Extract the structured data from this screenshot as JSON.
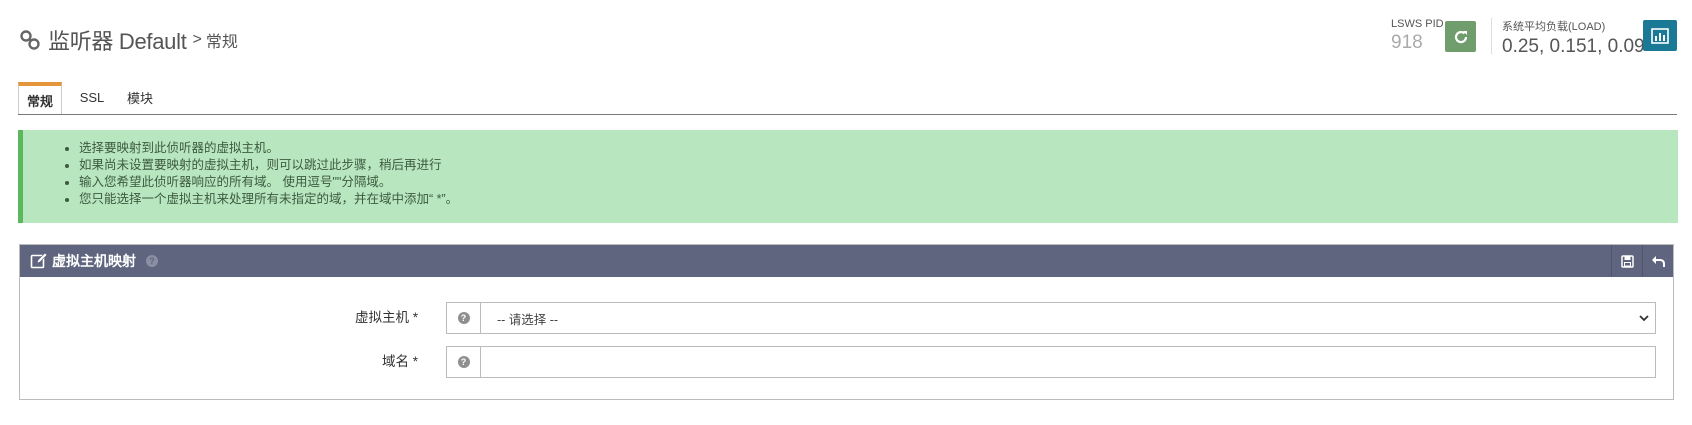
{
  "header": {
    "title": "监听器 Default",
    "separator": ">",
    "subtitle": "常规"
  },
  "status": {
    "pid_label": "LSWS PID",
    "pid_value": "918",
    "load_label": "系统平均负载(LOAD)",
    "load_value": "0.25, 0.151, 0.09"
  },
  "tabs": [
    {
      "label": "常规",
      "active": true
    },
    {
      "label": "SSL",
      "active": false
    },
    {
      "label": "模块",
      "active": false
    }
  ],
  "info": {
    "items": [
      "选择要映射到此侦听器的虚拟主机。",
      "如果尚未设置要映射的虚拟主机，则可以跳过此步骤，稍后再进行",
      "输入您希望此侦听器响应的所有域。 使用逗号\"\"分隔域。",
      "您只能选择一个虚拟主机来处理所有未指定的域，并在域中添加“ *”。"
    ]
  },
  "panel": {
    "title": "虚拟主机映射",
    "fields": [
      {
        "label": "虚拟主机 *",
        "type": "select",
        "value": "-- 请选择 --"
      },
      {
        "label": "域名 *",
        "type": "text",
        "value": ""
      }
    ]
  },
  "colors": {
    "accent_tab": "#e5953a",
    "refresh_btn": "#6f9d6b",
    "chart_btn": "#1a7a96",
    "panel_header": "#5f657e",
    "info_bg": "#b8e6bf",
    "info_border": "#5cb85c"
  }
}
